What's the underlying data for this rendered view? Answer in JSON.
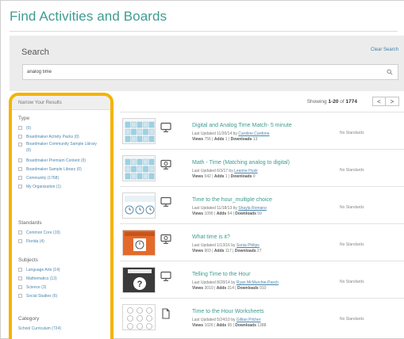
{
  "page": {
    "title": "Find Activities and Boards"
  },
  "search": {
    "label": "Search",
    "clear_label": "Clear Search",
    "value": "analog time"
  },
  "sidebar": {
    "header": "Narrow Your Results",
    "type": {
      "title": "Type",
      "items": [
        {
          "label": "(0)"
        },
        {
          "label": "Boardmaker Activity Packs (0)"
        },
        {
          "label": "Boardmaker Community Sample Library (0)"
        },
        {
          "label": "Boardmaker Premium Content (0)"
        },
        {
          "label": "Boardmaker Sample Library (0)"
        },
        {
          "label": "Community (1768)"
        },
        {
          "label": "My Organization (1)"
        }
      ]
    },
    "standards": {
      "title": "Standards",
      "items": [
        {
          "label": "Common Core (19)"
        },
        {
          "label": "Florida (4)"
        }
      ]
    },
    "subjects": {
      "title": "Subjects",
      "items": [
        {
          "label": "Language Arts (14)"
        },
        {
          "label": "Mathematics (13)"
        },
        {
          "label": "Science (3)"
        },
        {
          "label": "Social Studies (6)"
        }
      ]
    },
    "category": {
      "title": "Category",
      "items": [
        {
          "label": "School Curriculum (724)"
        }
      ]
    }
  },
  "results": {
    "showing_prefix": "Showing",
    "range": "1-20",
    "of_word": "of",
    "total": "1774",
    "prev_label": "<",
    "next_label": ">",
    "items": [
      {
        "title": "Digital and Analog Time Match- 5 minute",
        "updated": "Last Updated 11/20/14 by",
        "author": "Caroline Cardone",
        "views_label": "Views",
        "views": "756",
        "adds_label": "Adds",
        "adds": "1",
        "downloads_label": "Downloads",
        "downloads": "13",
        "standards": "No Standards",
        "type_icon": "monitor-icon",
        "thumb": "grid"
      },
      {
        "title": "Math - Time (Matching analog to digital)",
        "updated": "Last Updated 6/3/17 by",
        "author": "Leanne Husk",
        "views_label": "Views",
        "views": "542",
        "adds_label": "Adds",
        "adds": "1",
        "downloads_label": "Downloads",
        "downloads": "0",
        "standards": "No Standards",
        "type_icon": "interactive-monitor-icon",
        "thumb": "grid"
      },
      {
        "title": "Time to the hour_multiple choice",
        "updated": "Last Updated 11/18/13 by",
        "author": "Shayla Romano",
        "views_label": "Views",
        "views": "1096",
        "adds_label": "Adds",
        "adds": "64",
        "downloads_label": "Downloads",
        "downloads": "59",
        "standards": "No Standards",
        "type_icon": "monitor-icon",
        "thumb": "clocks"
      },
      {
        "title": "What time is it?",
        "updated": "Last Updated 1/13/16 by",
        "author": "Sonia Philips",
        "views_label": "Views",
        "views": "903",
        "adds_label": "Adds",
        "adds": "117",
        "downloads_label": "Downloads",
        "downloads": "27",
        "standards": "No Standards",
        "type_icon": "interactive-monitor-icon",
        "thumb": "orange"
      },
      {
        "title": "Telling Time to the Hour",
        "updated": "Last Updated 8/28/14 by",
        "author": "Ryan McMurchie-Pasch",
        "views_label": "Views",
        "views": "3010",
        "adds_label": "Adds",
        "adds": "314",
        "downloads_label": "Downloads",
        "downloads": "910",
        "standards": "No Standards",
        "type_icon": "monitor-icon",
        "thumb": "dark"
      },
      {
        "title": "Time to the Hour Worksheets",
        "updated": "Last Updated 5/24/10 by",
        "author": "Gillian Pilcher",
        "views_label": "Views",
        "views": "1026",
        "adds_label": "Adds",
        "adds": "95",
        "downloads_label": "Downloads",
        "downloads": "1388",
        "standards": "No Standards",
        "type_icon": "document-icon",
        "thumb": "sheet"
      }
    ]
  },
  "colors": {
    "accent": "#3e9c8f",
    "link": "#4b86ad",
    "highlight": "#f4b400"
  }
}
